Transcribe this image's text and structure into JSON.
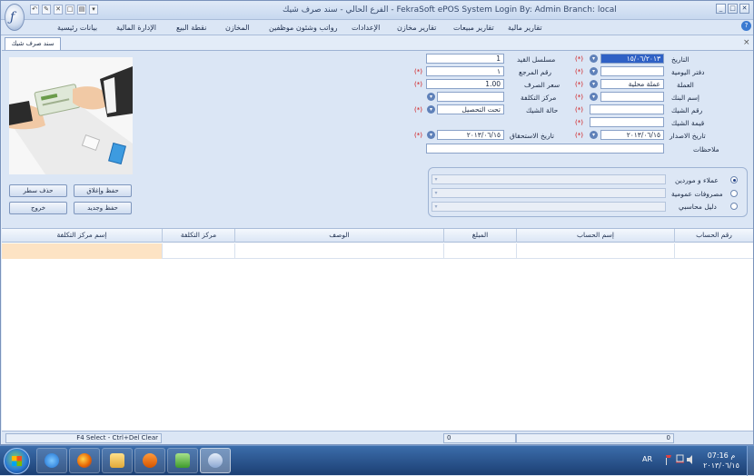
{
  "window": {
    "title": "الفرع الحالي  - سند صرف شيك - FekraSoft ePOS System   Login By: Admin   Branch: local"
  },
  "quick_access": [
    "↶",
    "✎",
    "✕",
    "□",
    "▤",
    "▾"
  ],
  "window_controls": [
    "_",
    "□",
    "✕"
  ],
  "menu": [
    "بيانات رئيسية",
    "الإدارة المالية",
    "نقطة البيع",
    "المخازن",
    "رواتب وشئون موظفين",
    "الإعدادات",
    "تقارير مخازن",
    "تقارير مبيعات",
    "تقارير مالية"
  ],
  "help_label": "?",
  "tab": {
    "label": "سند صرف شيك",
    "close": "×"
  },
  "required_mark": "(*)",
  "dropdown_glyph": "▾",
  "form": {
    "date": {
      "label": "التاريخ",
      "value": "١٥/٠٦/٢٠١٣"
    },
    "journal": {
      "label": "دفتر اليومية",
      "value": ""
    },
    "currency": {
      "label": "العملة",
      "value": "عملة محلية"
    },
    "bank_name": {
      "label": "إسم البنك",
      "value": ""
    },
    "cheque_no": {
      "label": "رقم الشيك",
      "value": ""
    },
    "cheque_amount": {
      "label": "قيمة الشيك",
      "value": ""
    },
    "issue_date": {
      "label": "تاريخ الاصدار",
      "value": "٢٠١٣/٠٦/١٥"
    },
    "notes": {
      "label": "ملاحظات",
      "value": ""
    },
    "serial": {
      "label": "مسلسل القيد",
      "value": "1"
    },
    "reference": {
      "label": "رقم المرجع",
      "value": "١"
    },
    "exchange_rate": {
      "label": "سعر الصرف",
      "value": "1.00"
    },
    "cost_center": {
      "label": "مركز التكلفة",
      "value": ""
    },
    "cheque_status": {
      "label": "حالة الشيك",
      "value": "تحت التحصيل"
    },
    "due_date": {
      "label": "تاريخ الاستحقاق",
      "value": "٢٠١٣/٠٦/١٥"
    }
  },
  "account_type": {
    "options": [
      "عملاء و موردين",
      "مصروفات عمومية",
      "دليل محاسبي"
    ],
    "selected": 0
  },
  "buttons": {
    "save_close": "حفظ وإغلاق",
    "delete_row": "حذف سطر",
    "save_new": "حفظ وجديد",
    "exit": "خروج"
  },
  "grid": {
    "columns": [
      "رقم الحساب",
      "إسم الحساب",
      "المبلغ",
      "الوصف",
      "مركز التكلفة",
      "إسم مركز التكلفة"
    ]
  },
  "status_bar": {
    "hint": "F4 Select - Ctrl+Del Clear",
    "total_1": "0",
    "total_2": "0"
  },
  "taskbar": {
    "language": "AR",
    "time": "م 07:16",
    "date": "٢٠١٣/٠٦/١٥",
    "apps": [
      "start-orb",
      "ie-icon",
      "firefox-icon",
      "explorer-icon",
      "media-player-icon",
      "recycle-bin-icon",
      "epos-icon"
    ]
  }
}
